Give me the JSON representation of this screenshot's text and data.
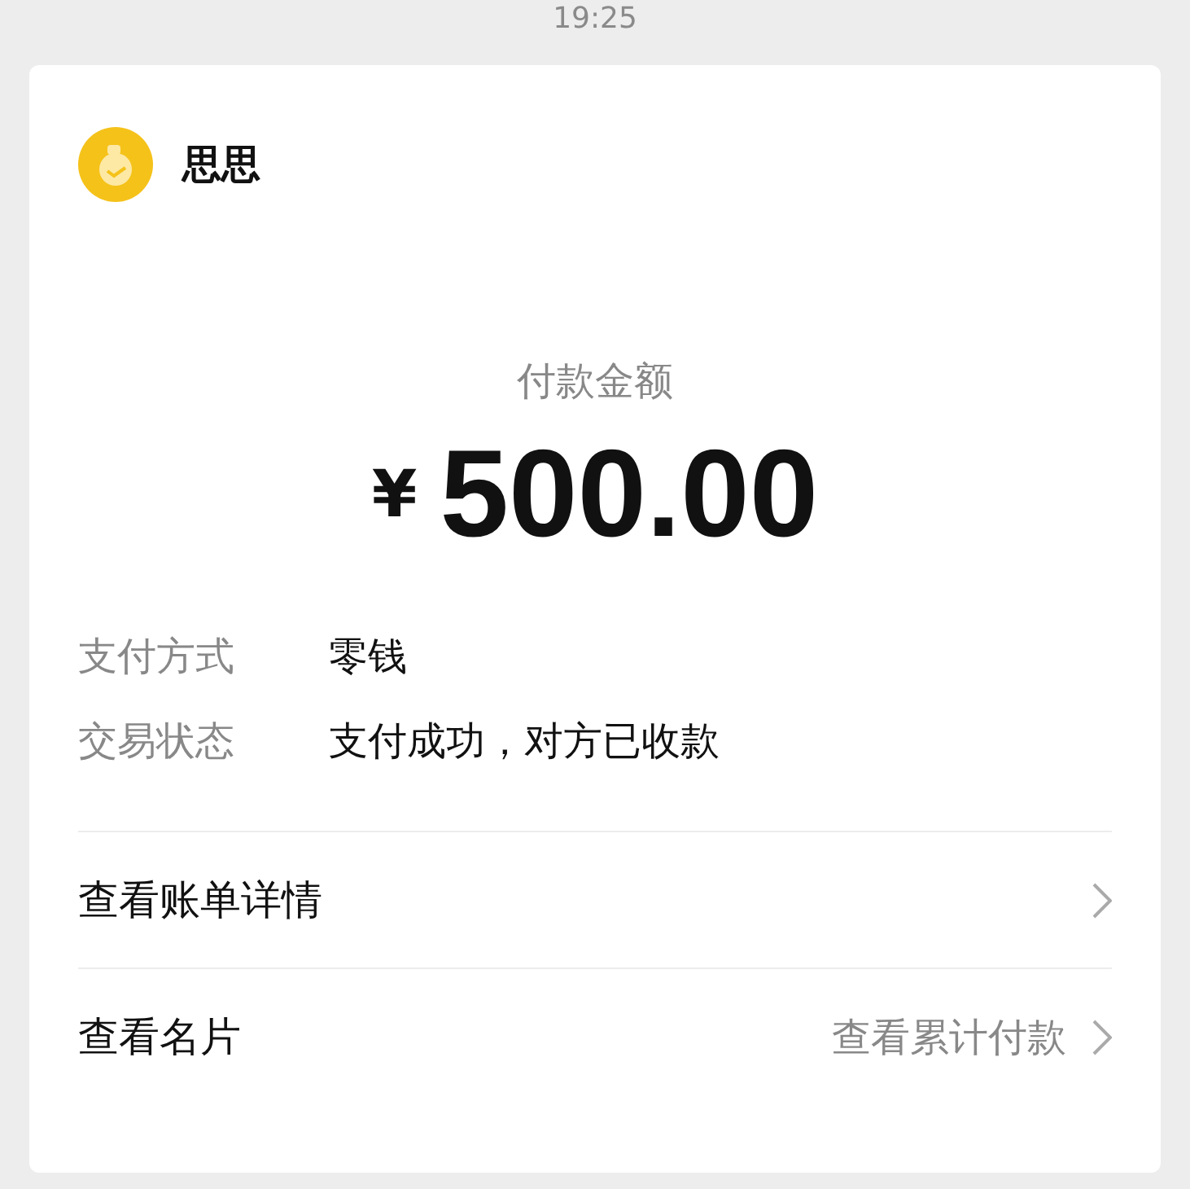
{
  "time": "19:25",
  "payee": {
    "name": "思思"
  },
  "amount": {
    "label": "付款金额",
    "currency": "¥",
    "value": "500.00"
  },
  "details": [
    {
      "label": "支付方式",
      "value": "零钱"
    },
    {
      "label": "交易状态",
      "value": "支付成功，对方已收款"
    }
  ],
  "links": [
    {
      "label": "查看账单详情"
    },
    {
      "label": "查看名片",
      "hint": "查看累计付款"
    }
  ]
}
